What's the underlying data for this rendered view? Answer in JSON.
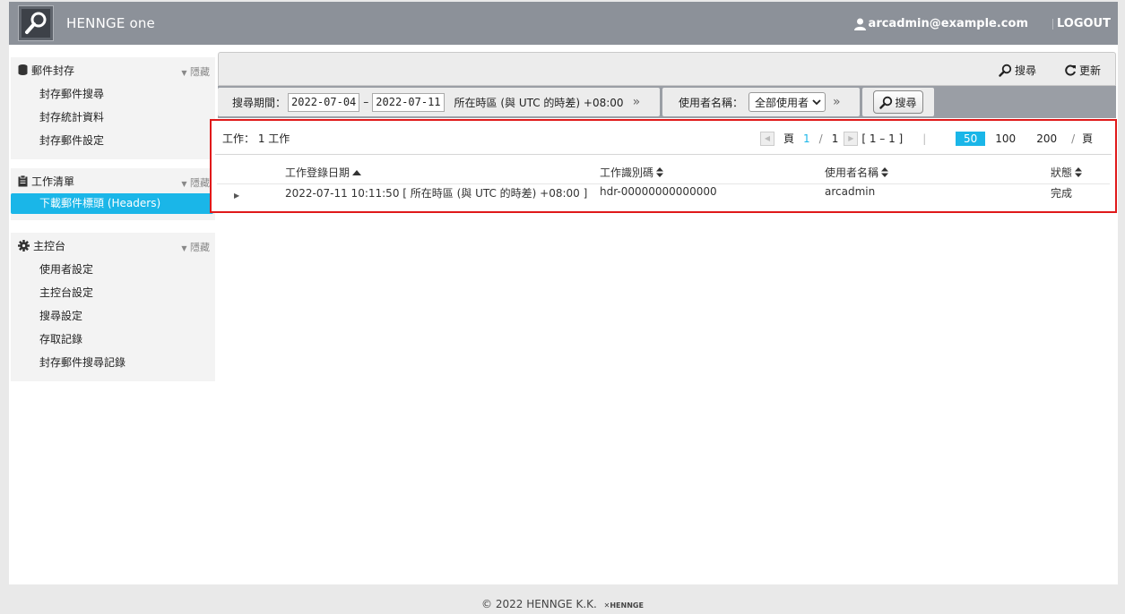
{
  "header": {
    "brand": "HENNGE",
    "brand_suffix": "one",
    "user": "arcadmin@example.com",
    "logout": "LOGOUT"
  },
  "sidebar": {
    "sections": [
      {
        "title": "郵件封存",
        "hide": "隱藏",
        "items": [
          "封存郵件搜尋",
          "封存統計資料",
          "封存郵件設定"
        ]
      },
      {
        "title": "工作清單",
        "hide": "隱藏",
        "items": [
          "下載郵件標頭 (Headers)"
        ]
      },
      {
        "title": "主控台",
        "hide": "隱藏",
        "items": [
          "使用者設定",
          "主控台設定",
          "搜尋設定",
          "存取記錄",
          "封存郵件搜尋記錄"
        ]
      }
    ]
  },
  "toolbar": {
    "search": "搜尋",
    "refresh": "更新"
  },
  "filter": {
    "period_label": "搜尋期間：",
    "date_from": "2022-07-04",
    "dash": "–",
    "date_to": "2022-07-11",
    "timezone": "所在時區 (與 UTC 的時差) +08:00",
    "more": "»",
    "user_label": "使用者名稱：",
    "user_value": "全部使用者",
    "search_button": "搜尋"
  },
  "results": {
    "count_label": "工作：",
    "count_value": "1 工作",
    "page_label": "頁",
    "page_current": "1",
    "page_slash": "/",
    "page_total": "1",
    "range": "[ 1 – 1 ]",
    "sizes": [
      "50",
      "100",
      "200"
    ],
    "size_unit": "頁",
    "columns": [
      "工作登錄日期",
      "工作識別碼",
      "使用者名稱",
      "狀態"
    ],
    "rows": [
      {
        "date": "2022-07-11 10:11:50 [ 所在時區 (與 UTC 的時差) +08:00 ]",
        "id": "hdr-00000000000000",
        "user": "arcadmin",
        "status": "完成"
      }
    ]
  },
  "footer": {
    "copyright": "© 2022 HENNGE K.K.",
    "logo": "HENNGE"
  }
}
